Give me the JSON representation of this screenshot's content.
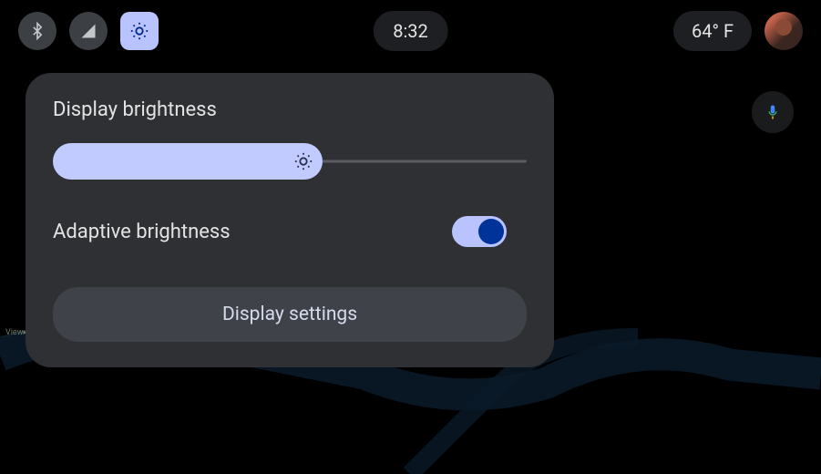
{
  "statusbar": {
    "time": "8:32",
    "temperature": "64° F"
  },
  "panel": {
    "title": "Display brightness",
    "slider_percent": 57,
    "adaptive_label": "Adaptive brightness",
    "adaptive_on": true,
    "settings_button": "Display settings"
  },
  "map": {
    "label": "View"
  }
}
